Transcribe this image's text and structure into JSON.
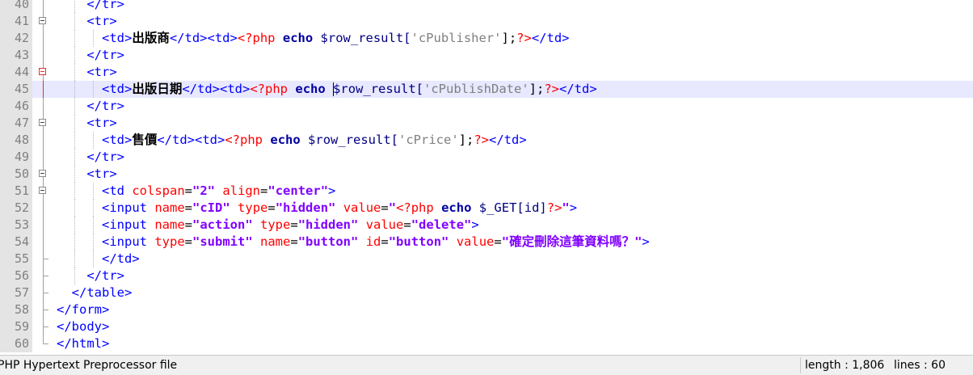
{
  "editor": {
    "line_numbers": [
      "40",
      "41",
      "42",
      "43",
      "44",
      "45",
      "46",
      "47",
      "48",
      "49",
      "50",
      "51",
      "52",
      "53",
      "54",
      "55",
      "56",
      "57",
      "58",
      "59",
      "60"
    ],
    "current_line": "45",
    "lines": {
      "l40": {
        "close": "</tr>"
      },
      "l41": {
        "open": "<tr>"
      },
      "l42": {
        "td1": "<td>",
        "label": "出版商",
        "td2": "</td><td>",
        "php_open": "<?php",
        "echo": "echo",
        "var": "$row_result[",
        "key": "'cPublisher'",
        "tail": "];",
        "php_close": "?>",
        "td3": "</td>"
      },
      "l43": {
        "close": "</tr>"
      },
      "l44": {
        "open": "<tr>"
      },
      "l45": {
        "td1": "<td>",
        "label": "出版日期",
        "td2": "</td><td>",
        "php_open": "<?php",
        "echo": "echo",
        "var": "$row_result[",
        "key": "'cPublishDate'",
        "tail": "];",
        "php_close": "?>",
        "td3": "</td>"
      },
      "l46": {
        "close": "</tr>"
      },
      "l47": {
        "open": "<tr>"
      },
      "l48": {
        "td1": "<td>",
        "label": "售價",
        "td2": "</td><td>",
        "php_open": "<?php",
        "echo": "echo",
        "var": "$row_result[",
        "key": "'cPrice'",
        "tail": "];",
        "php_close": "?>",
        "td3": "</td>"
      },
      "l49": {
        "close": "</tr>"
      },
      "l50": {
        "open": "<tr>"
      },
      "l51": {
        "tag": "<td",
        "a1": "colspan",
        "v1": "\"2\"",
        "a2": "align",
        "v2": "\"center\"",
        "end": ">"
      },
      "l52": {
        "tag": "<input",
        "a1": "name",
        "v1": "\"cID\"",
        "a2": "type",
        "v2": "\"hidden\"",
        "a3": "value",
        "q1": "\"",
        "php_open": "<?php",
        "echo": "echo",
        "var": "$_GET[id]",
        "php_close": "?>",
        "q2": "\"",
        "end": ">"
      },
      "l53": {
        "tag": "<input",
        "a1": "name",
        "v1": "\"action\"",
        "a2": "type",
        "v2": "\"hidden\"",
        "a3": "value",
        "v3": "\"delete\"",
        "end": ">"
      },
      "l54": {
        "tag": "<input",
        "a1": "type",
        "v1": "\"submit\"",
        "a2": "name",
        "v2": "\"button\"",
        "a3": "id",
        "v3": "\"button\"",
        "a4": "value",
        "q1": "\"",
        "v4": "確定刪除這筆資料嗎？",
        "q2": "\"",
        "end": ">"
      },
      "l55": {
        "close": "</td>"
      },
      "l56": {
        "close": "</tr>"
      },
      "l57": {
        "close": "</table>"
      },
      "l58": {
        "close": "</form>"
      },
      "l59": {
        "close": "</body>"
      },
      "l60": {
        "close": "</html>"
      }
    }
  },
  "statusbar": {
    "file_type": "PHP Hypertext Preprocessor file",
    "length": "length : 1,806",
    "lines": "lines : 60"
  },
  "colors": {
    "tag": "#0000ff",
    "attribute": "#ff0000",
    "attribute_value": "#8000ff",
    "php_delimiter": "#ff0000",
    "keyword": "#0000a0",
    "string": "#808080",
    "gutter": "#e4e4e4",
    "current_line": "#e8e8ff"
  }
}
